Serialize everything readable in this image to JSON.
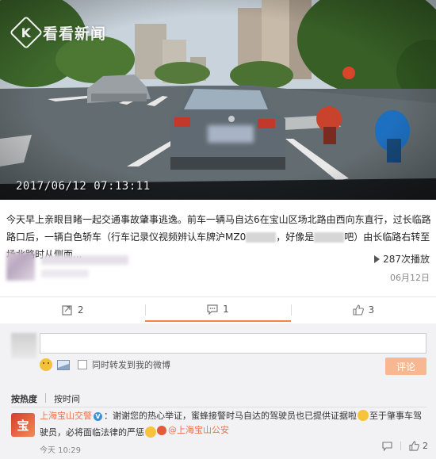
{
  "video": {
    "brand_mark": "K",
    "brand_name": "看看新闻",
    "timestamp": "2017/06/12  07:13:11"
  },
  "post": {
    "text_part1": "今天早上亲眼目睹一起交通事故肇事逃逸。前车一辆马自达6在宝山区场北路由西向东直行，过长临路路口后，一辆白色轿车（行车记录仪视频辨认车牌沪MZ0",
    "text_part2": "，好像是",
    "text_part3": "吧）由长临路右转至场北路时从侧面...",
    "plays": "287次播放",
    "date": "06月12日"
  },
  "actions": {
    "repost_count": "2",
    "comment_count": "1",
    "like_count": "3"
  },
  "comment_form": {
    "placeholder": "",
    "sync_label": "同时转发到我的微博",
    "submit_label": "评论"
  },
  "sort": {
    "hot": "按热度",
    "time": "按时间"
  },
  "comment": {
    "avatar_char": "宝",
    "user": "上海宝山交警",
    "text_a": "：谢谢您的热心举证，蜜蜂接警时马自达的驾驶员也已提供证据啦",
    "text_b": "至于肇事车驾驶员，必将面临法律的严惩",
    "mention": "@上海宝山公安",
    "time": "今天 10:29",
    "like_count": "2"
  },
  "colors": {
    "accent": "#ff8140",
    "link": "#eb7350",
    "submit_disabled": "#f7b790"
  }
}
